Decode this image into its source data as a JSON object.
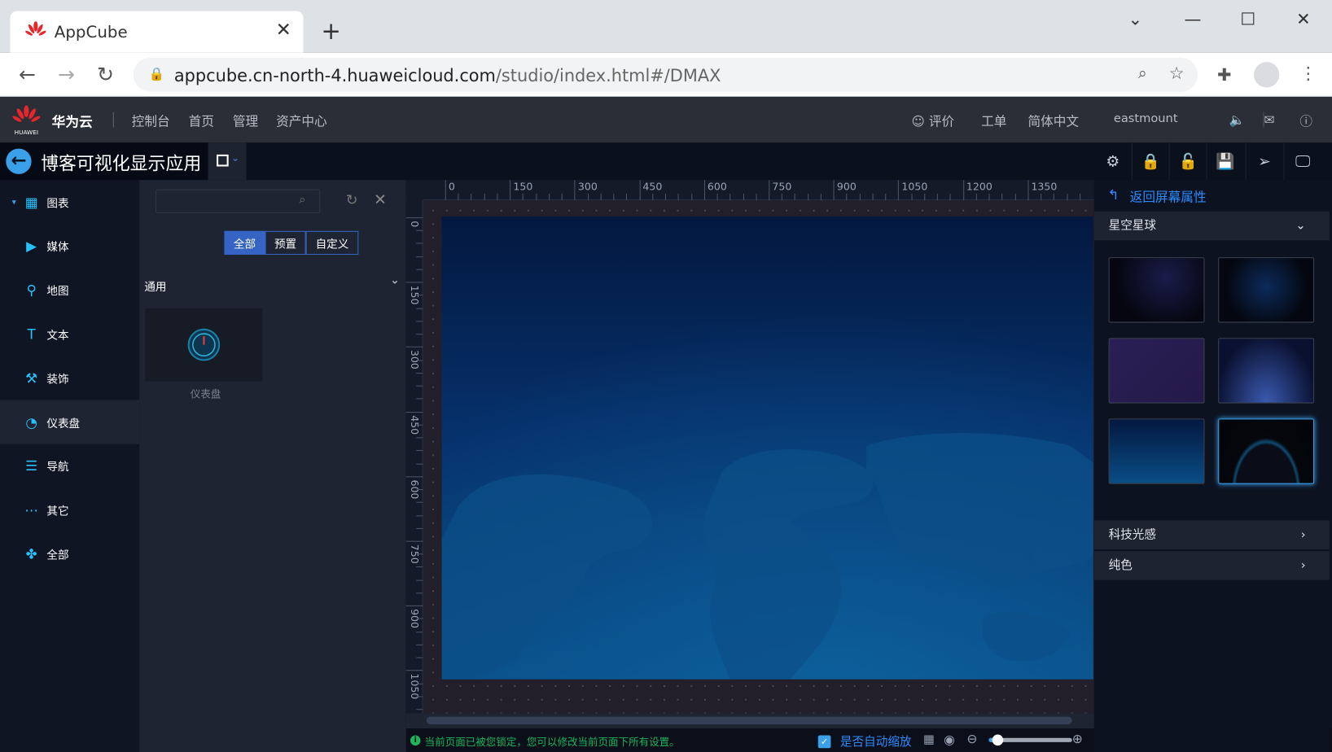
{
  "browser": {
    "tab_title": "AppCube",
    "url_host": "appcube.cn-north-4.huaweicloud.com",
    "url_path": "/studio/index.html#/DMAX",
    "close": "✕",
    "new_tab": "+"
  },
  "topnav": {
    "brand": "华为云",
    "logo_text": "HUAWEI",
    "links": [
      "控制台",
      "首页",
      "管理",
      "资产中心"
    ],
    "right": {
      "rate": "评价",
      "ticket": "工单",
      "language": "简体中文",
      "user": "eastmount"
    }
  },
  "app": {
    "title": "博客可视化显示应用",
    "toolbar_icons": [
      "gear-icon",
      "lock-icon",
      "unlock-icon",
      "save-icon",
      "publish-icon",
      "preview-icon"
    ]
  },
  "sidebar": {
    "items": [
      {
        "label": "图表",
        "icon": "grid-icon"
      },
      {
        "label": "媒体",
        "icon": "media-icon"
      },
      {
        "label": "地图",
        "icon": "map-pin-icon"
      },
      {
        "label": "文本",
        "icon": "text-icon"
      },
      {
        "label": "装饰",
        "icon": "paint-roller-icon"
      },
      {
        "label": "仪表盘",
        "icon": "dashboard-icon",
        "active": true
      },
      {
        "label": "导航",
        "icon": "list-icon"
      },
      {
        "label": "其它",
        "icon": "more-icon"
      },
      {
        "label": "全部",
        "icon": "all-icon"
      }
    ]
  },
  "panel": {
    "search_placeholder": "",
    "filters": [
      "全部",
      "预置",
      "自定义"
    ],
    "active_filter": "全部",
    "section": "通用",
    "components": [
      {
        "label": "仪表盘"
      }
    ]
  },
  "ruler": {
    "top": [
      "0",
      "150",
      "300",
      "450",
      "600",
      "750",
      "900",
      "1050",
      "1200",
      "1350"
    ],
    "left": [
      "0",
      "150",
      "300",
      "450",
      "600",
      "750",
      "900",
      "1050"
    ]
  },
  "status": {
    "message": "当前页面已被您锁定，您可以修改当前页面下所有设置。",
    "auto_scale_label": "是否自动缩放",
    "auto_scale_checked": true,
    "zoom_level": 0.05
  },
  "right_panel": {
    "back_label": "返回屏幕属性",
    "groups": [
      {
        "label": "星空星球",
        "expanded": true
      },
      {
        "label": "科技光感",
        "expanded": false
      },
      {
        "label": "纯色",
        "expanded": false
      }
    ],
    "selected_thumbnail": 5
  },
  "colors": {
    "accent": "#2e8bff",
    "status_green": "#1fb35b",
    "active_filter": "#3564c4"
  }
}
